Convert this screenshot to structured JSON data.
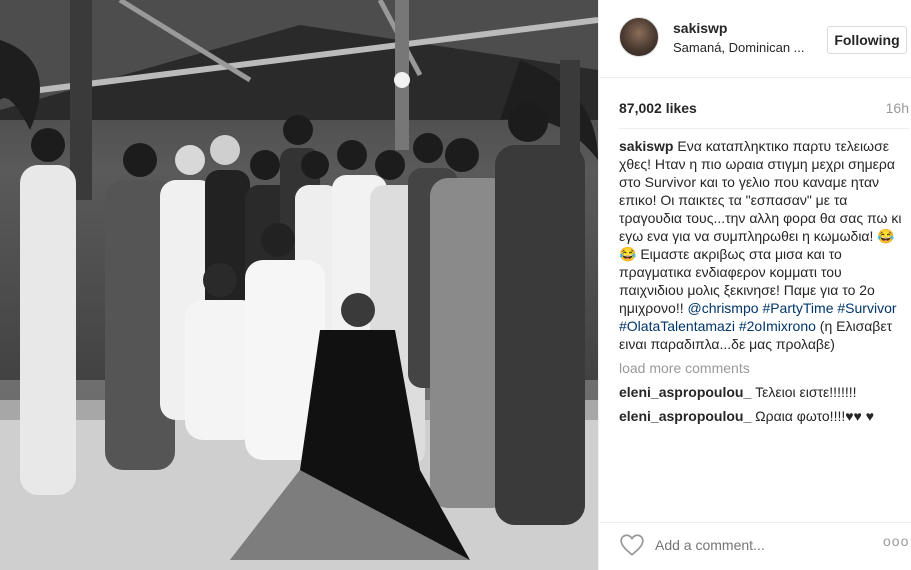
{
  "post": {
    "username": "sakiswp",
    "location": "Samaná, Dominican ...",
    "follow_label": "Following",
    "likes": "87,002 likes",
    "time": "16h"
  },
  "caption": {
    "user": "sakiswp",
    "text_part1": "Ενα καταπληκτικο παρτυ τελειωσε χθες! Ηταν η πιο ωραια στιγμη μεχρι σημερα στο Survivor και το γελιο που καναμε ηταν επικο! Οι παικτες τα \"εσπασαν\" με τα τραγουδια τους...την αλλη φορα θα σας πω κι εγω ενα για να συμπληρωθει η κωμωδια! 😂😂 Ειμαστε ακριβως στα μισα και το πραγματικα ενδιαφερον κομματι του παιχνιδιου μολις ξεκινησε! Παμε για το 2ο ημιχρονο!! ",
    "mention": "@chrismpo",
    "hashtag1": "#PartyTime",
    "hashtag2": "#Survivor",
    "hashtag3": "#OlataTalentamazi",
    "hashtag4": "#2oImixrono",
    "text_part2": " (η Ελισαβετ ειναι παραδιπλα...δε μας προλαβε)"
  },
  "load_more": "load more comments",
  "comments": [
    {
      "user": "eleni_aspropoulou_",
      "text": "Τελειοι ειστε!!!!!!!"
    },
    {
      "user": "eleni_aspropoulou_",
      "text": "Ωραια φωτο!!!!♥♥ ♥"
    }
  ],
  "footer": {
    "add_comment_placeholder": "Add a comment...",
    "more_label": "ooo"
  }
}
